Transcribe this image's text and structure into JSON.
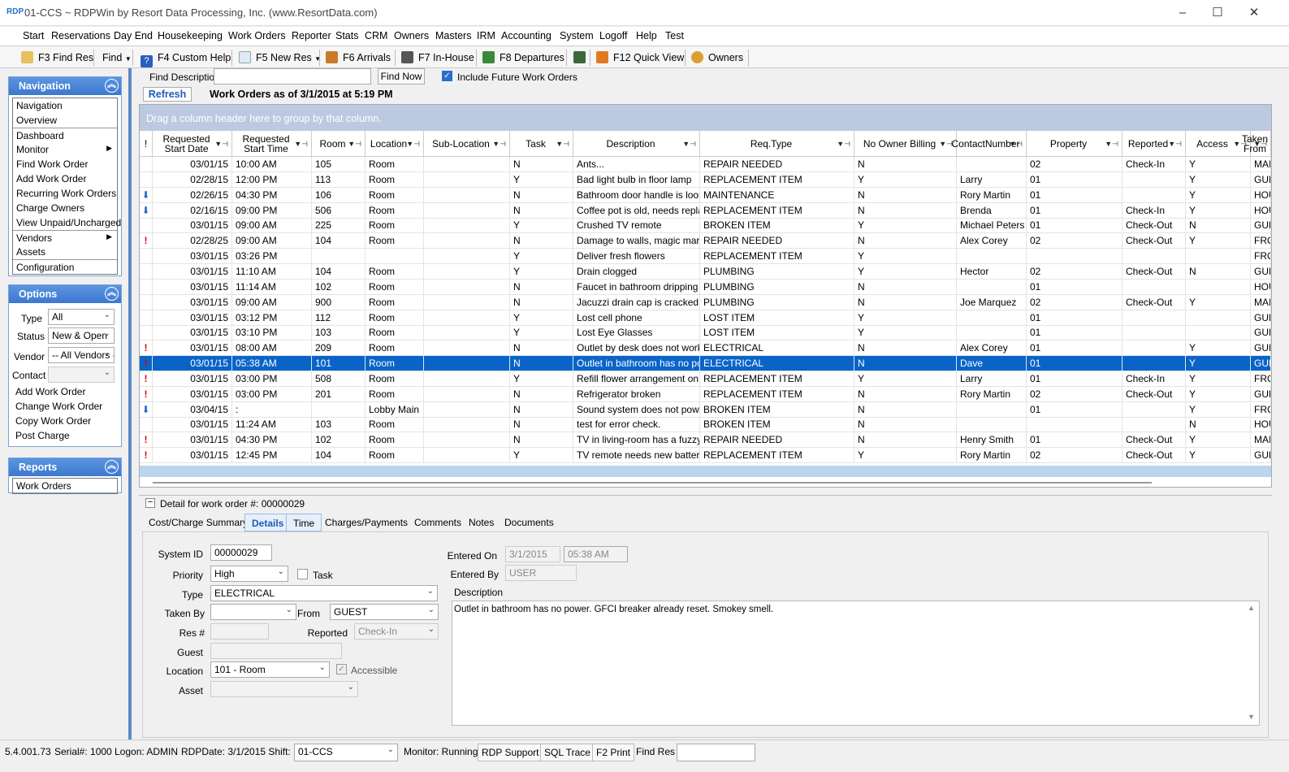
{
  "titlebar": {
    "logo": "RDP",
    "title": "01-CCS ~ RDPWin by Resort Data Processing, Inc. (www.ResortData.com)",
    "min": "–",
    "max": "☐",
    "close": "✕"
  },
  "menu": [
    "Start",
    "Reservations",
    "Day End",
    "Housekeeping",
    "Work Orders",
    "Reporter",
    "Stats",
    "CRM",
    "Owners",
    "Masters",
    "IRM",
    "Accounting",
    "System",
    "Logoff",
    "Help",
    "Test"
  ],
  "toolbar": {
    "find_res": "F3 Find Res",
    "find": "Find",
    "custom_help": "F4 Custom Help",
    "new_res": "F5 New Res",
    "arrivals": "F6 Arrivals",
    "in_house": "F7 In-House",
    "departures": "F8 Departures",
    "quick_view": "F12 Quick View",
    "owners": "Owners"
  },
  "navigation": {
    "title": "Navigation",
    "items": [
      "Navigation",
      "Overview",
      "Dashboard",
      "Monitor",
      "Find Work Order",
      "Add Work Order",
      "Recurring Work Orders",
      "Charge Owners",
      "View Unpaid/Uncharged",
      "Vendors",
      "Assets",
      "Configuration"
    ]
  },
  "options": {
    "title": "Options",
    "type_label": "Type",
    "type_value": "All",
    "status_label": "Status",
    "status_value": "New & Open",
    "vendor_label": "Vendor",
    "vendor_value": "-- All Vendors --",
    "contact_label": "Contact",
    "contact_value": "",
    "actions": [
      "Add Work Order",
      "Change Work Order",
      "Copy Work Order",
      "Post Charge"
    ]
  },
  "reports": {
    "title": "Reports",
    "items": [
      "Work Orders"
    ]
  },
  "findbar": {
    "find_label": "Find Description",
    "find_value": "",
    "find_now": "Find Now",
    "future_label": "Include Future Work Orders",
    "future_checked": true,
    "refresh": "Refresh",
    "heading": "Work Orders as of 3/1/2015 at 5:19 PM"
  },
  "grid": {
    "banner": "Drag a column header here to group by that column.",
    "columns": [
      "!",
      "Requested Start Date",
      "Requested Start Time",
      "Room",
      "Location",
      "Sub-Location",
      "Task",
      "Description",
      "Req.Type",
      "No Owner Billing",
      "ContactNumber",
      "Property",
      "Reported",
      "Access",
      "Taken From"
    ],
    "rows": [
      [
        "",
        "03/01/15",
        "10:00 AM",
        "105",
        "Room",
        "",
        "N",
        "Ants...",
        "REPAIR NEEDED",
        "N",
        "",
        "02",
        "Check-In",
        "Y",
        "MAINTENANCE"
      ],
      [
        "",
        "02/28/15",
        "12:00 PM",
        "113",
        "Room",
        "",
        "Y",
        "Bad light bulb in floor lamp",
        "REPLACEMENT ITEM",
        "Y",
        "Larry",
        "01",
        "",
        "Y",
        "GUEST"
      ],
      [
        "down",
        "02/26/15",
        "04:30 PM",
        "106",
        "Room",
        "",
        "N",
        "Bathroom door handle is loose",
        "MAINTENANCE",
        "N",
        "Rory Martin",
        "01",
        "",
        "Y",
        "HOUSEKEEPING"
      ],
      [
        "down",
        "02/16/15",
        "09:00 PM",
        "506",
        "Room",
        "",
        "N",
        "Coffee pot is old, needs replacement",
        "REPLACEMENT ITEM",
        "N",
        "Brenda",
        "01",
        "Check-In",
        "Y",
        "HOUSEKEEPING"
      ],
      [
        "",
        "03/01/15",
        "09:00 AM",
        "225",
        "Room",
        "",
        "Y",
        "Crushed TV remote",
        "BROKEN ITEM",
        "Y",
        "Michael Peters",
        "01",
        "Check-Out",
        "N",
        "GUEST"
      ],
      [
        "flag",
        "02/28/25",
        "09:00 AM",
        "104",
        "Room",
        "",
        "N",
        "Damage to walls, magic marker str...",
        "REPAIR NEEDED",
        "N",
        "Alex Corey",
        "02",
        "Check-Out",
        "Y",
        "FRONT DESK"
      ],
      [
        "",
        "03/01/15",
        "03:26 PM",
        "",
        "",
        "",
        "Y",
        "Deliver fresh flowers",
        "REPLACEMENT ITEM",
        "Y",
        "",
        "",
        "",
        "",
        "FRONT DESK"
      ],
      [
        "",
        "03/01/15",
        "11:10 AM",
        "104",
        "Room",
        "",
        "Y",
        "Drain clogged",
        "PLUMBING",
        "Y",
        "Hector",
        "02",
        "Check-Out",
        "N",
        "GUEST"
      ],
      [
        "",
        "03/01/15",
        "11:14 AM",
        "102",
        "Room",
        "",
        "N",
        "Faucet in bathroom dripping",
        "PLUMBING",
        "N",
        "",
        "01",
        "",
        "",
        "HOUSEKEEPING"
      ],
      [
        "",
        "03/01/15",
        "09:00 AM",
        "900",
        "Room",
        "",
        "N",
        "Jacuzzi drain cap is cracked",
        "PLUMBING",
        "N",
        "Joe Marquez",
        "02",
        "Check-Out",
        "Y",
        "MAINTENANCE"
      ],
      [
        "",
        "03/01/15",
        "03:12 PM",
        "112",
        "Room",
        "",
        "Y",
        "Lost cell phone",
        "LOST ITEM",
        "Y",
        "",
        "01",
        "",
        "",
        "GUEST"
      ],
      [
        "",
        "03/01/15",
        "03:10 PM",
        "103",
        "Room",
        "",
        "Y",
        "Lost Eye Glasses",
        "LOST ITEM",
        "Y",
        "",
        "01",
        "",
        "",
        "GUEST"
      ],
      [
        "flag",
        "03/01/15",
        "08:00 AM",
        "209",
        "Room",
        "",
        "N",
        "Outlet by desk does not work",
        "ELECTRICAL",
        "N",
        "Alex Corey",
        "01",
        "",
        "Y",
        "GUEST"
      ],
      [
        "flag",
        "03/01/15",
        "05:38 AM",
        "101",
        "Room",
        "",
        "N",
        "Outlet in bathroom has no power...",
        "ELECTRICAL",
        "N",
        "Dave",
        "01",
        "",
        "Y",
        "GUEST"
      ],
      [
        "flag",
        "03/01/15",
        "03:00 PM",
        "508",
        "Room",
        "",
        "Y",
        "Refill flower arrangement on dining...",
        "REPLACEMENT ITEM",
        "Y",
        "Larry",
        "01",
        "Check-In",
        "Y",
        "FRONT DESK"
      ],
      [
        "flag",
        "03/01/15",
        "03:00 PM",
        "201",
        "Room",
        "",
        "N",
        "Refrigerator broken",
        "REPLACEMENT ITEM",
        "N",
        "Rory Martin",
        "02",
        "Check-Out",
        "Y",
        "GUEST"
      ],
      [
        "down",
        "03/04/15",
        ":",
        "",
        "Lobby Main",
        "",
        "N",
        "Sound system does not power on",
        "BROKEN ITEM",
        "N",
        "",
        "01",
        "",
        "Y",
        "FRONT DESK"
      ],
      [
        "",
        "03/01/15",
        "11:24 AM",
        "103",
        "Room",
        "",
        "N",
        "test for error check.",
        "BROKEN ITEM",
        "N",
        "",
        "",
        "",
        "N",
        "HOUSEKEEPING"
      ],
      [
        "flag",
        "03/01/15",
        "04:30 PM",
        "102",
        "Room",
        "",
        "N",
        "TV in living-room has a fuzzy picture",
        "REPAIR NEEDED",
        "N",
        "Henry Smith",
        "01",
        "Check-Out",
        "Y",
        "MAINTENANCE"
      ],
      [
        "flag",
        "03/01/15",
        "12:45 PM",
        "104",
        "Room",
        "",
        "Y",
        "TV remote needs new batteries",
        "REPLACEMENT ITEM",
        "Y",
        "Rory Martin",
        "02",
        "Check-Out",
        "Y",
        "GUEST"
      ]
    ],
    "selected_index": 13
  },
  "detail": {
    "header": "Detail for work order #: 00000029",
    "tabs": [
      "Cost/Charge Summary",
      "Details",
      "Time",
      "Charges/Payments",
      "Comments",
      "Notes",
      "Documents"
    ],
    "active_tab": "Details",
    "system_id_label": "System ID",
    "system_id": "00000029",
    "priority_label": "Priority",
    "priority": "High",
    "task_label": "Task",
    "type_label": "Type",
    "type": "ELECTRICAL",
    "taken_by_label": "Taken By",
    "taken_by": "",
    "from_label": "From",
    "from": "GUEST",
    "res_label": "Res #",
    "res": "",
    "reported_label": "Reported",
    "reported": "Check-In",
    "guest_label": "Guest",
    "guest": "",
    "location_label": "Location",
    "location": "101 - Room",
    "accessible_label": "Accessible",
    "asset_label": "Asset",
    "asset": "",
    "entered_on_label": "Entered On",
    "entered_on_date": "3/1/2015",
    "entered_on_time": "05:38 AM",
    "entered_by_label": "Entered By",
    "entered_by": "USER",
    "description_label": "Description",
    "description": "Outlet in bathroom has no power.  GFCI breaker already reset.  Smokey smell."
  },
  "status": {
    "version": "5.4.001.73",
    "serial": "Serial#: 1000",
    "logon": "Logon: ADMIN",
    "rdpdate": "RDPDate: 3/1/2015 Shift: 1",
    "property": "01-CCS",
    "monitor": "Monitor: Running",
    "rdp_support": "RDP Support",
    "sql_trace": "SQL Trace",
    "f2_print": "F2 Print",
    "find_res": "Find Res"
  },
  "colors": {
    "accent": "#3d78d0",
    "selected_row": "#0a64c8",
    "flag": "#dd0000"
  }
}
